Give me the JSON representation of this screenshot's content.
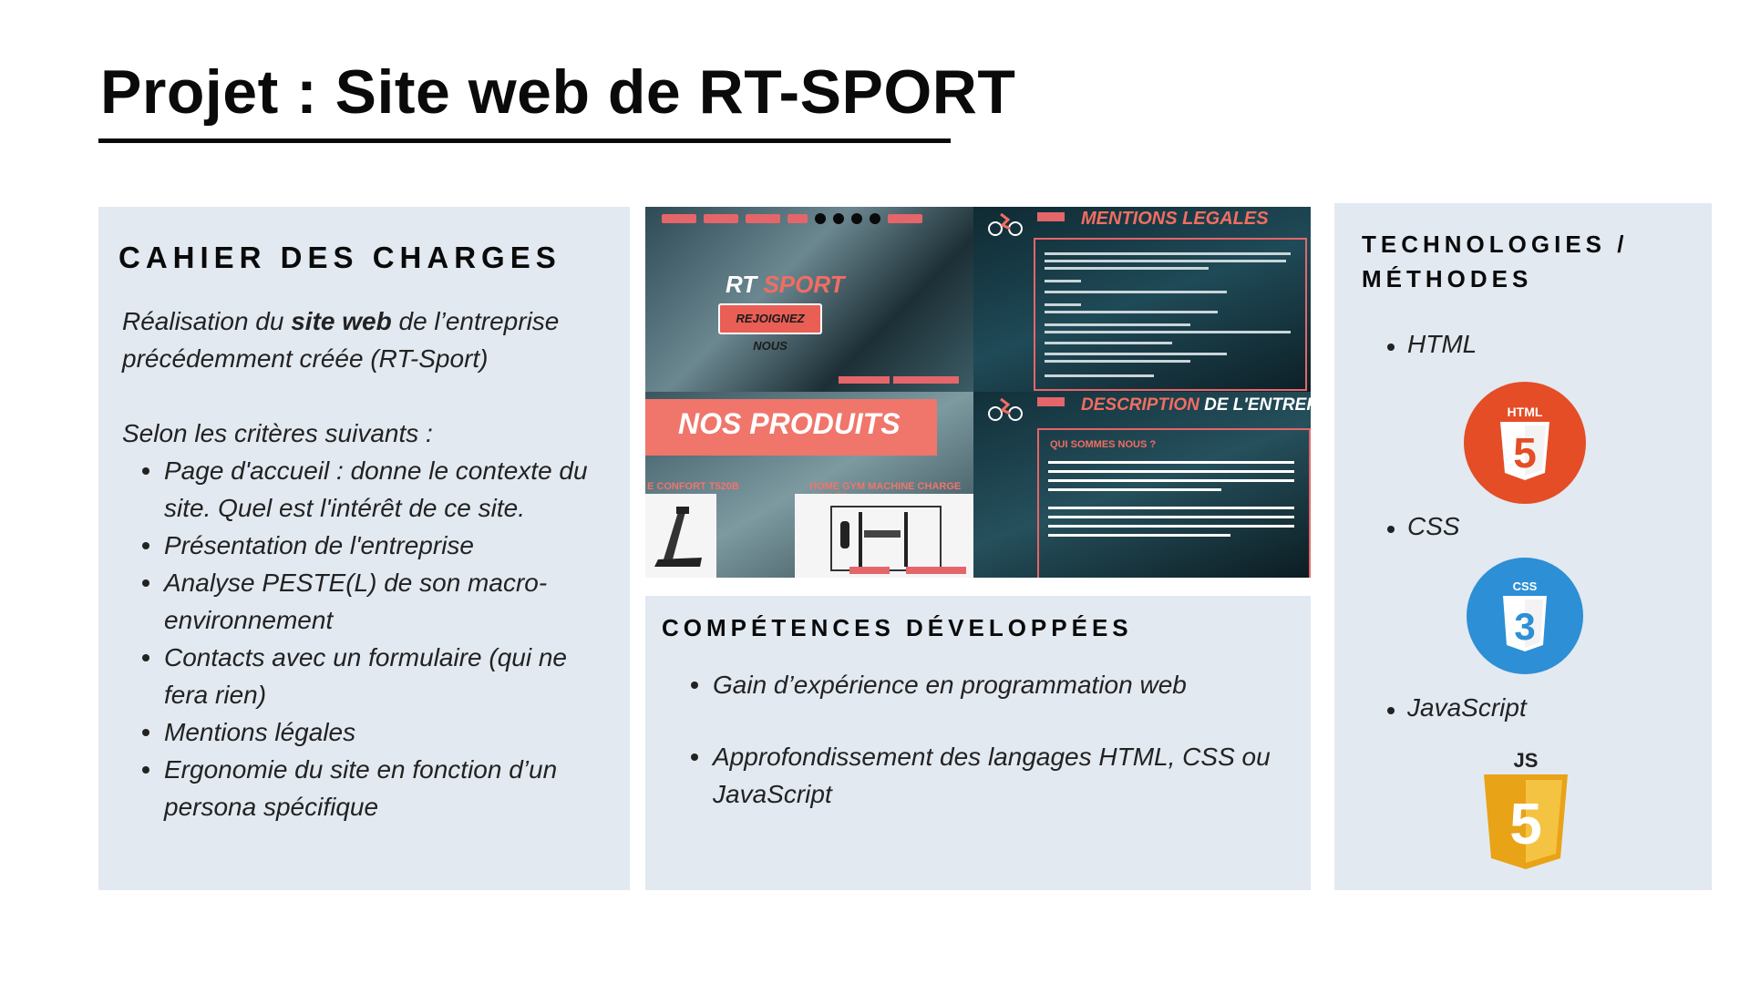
{
  "title": "Projet : Site web de RT-SPORT",
  "left_panel": {
    "heading": "CAHIER DES CHARGES",
    "intro_before": "Réalisation du ",
    "intro_bold": "site web",
    "intro_after": " de l’entreprise précédemment créée (RT-Sport)",
    "criteria_intro": "Selon les critères suivants :",
    "items": [
      "Page d'accueil : donne le contexte du site. Quel est l'intérêt de ce site.",
      "Présentation de l'entreprise",
      "Analyse PESTE(L) de son macro-environnement",
      "Contacts avec un formulaire (qui ne fera rien)",
      "Mentions légales",
      "Ergonomie du site en fonction d’un persona spécifique"
    ]
  },
  "collage": {
    "logo_rt": "RT",
    "logo_sport": "SPORT",
    "cta": "REJOIGNEZ NOUS",
    "mentions_title": "MENTIONS LEGALES",
    "produits_title": "NOS PRODUITS",
    "product_1": "E CONFORT T520B",
    "product_2": "HOME GYM MACHINE CHARGE GUIDÉE",
    "description_accent": "DESCRIPTION",
    "description_rest": " DE L'ENTREPPRIS",
    "qui_sommes_nous": "QUI SOMMES NOUS ?"
  },
  "mid_panel": {
    "heading": "COMPÉTENCES DÉVELOPPÉES",
    "items": [
      "Gain d’expérience en programmation web",
      "Approfondissement des langages HTML, CSS ou JavaScript"
    ]
  },
  "right_panel": {
    "heading_line1": "TECHNOLOGIES /",
    "heading_line2": "MÉTHODES",
    "items": [
      {
        "label": "HTML",
        "badge": "HTML",
        "digit": "5",
        "icon": "html5-icon",
        "color": "#e44d26"
      },
      {
        "label": "CSS",
        "badge": "CSS",
        "digit": "3",
        "icon": "css3-icon",
        "color": "#2d8fd5"
      },
      {
        "label": "JavaScript",
        "badge": "JS",
        "digit": "5",
        "icon": "js-icon",
        "color": "#f0b43a"
      }
    ]
  },
  "colors": {
    "panel_bg": "#e2e9f1",
    "accent_red": "#f26d62",
    "text": "#222222"
  }
}
